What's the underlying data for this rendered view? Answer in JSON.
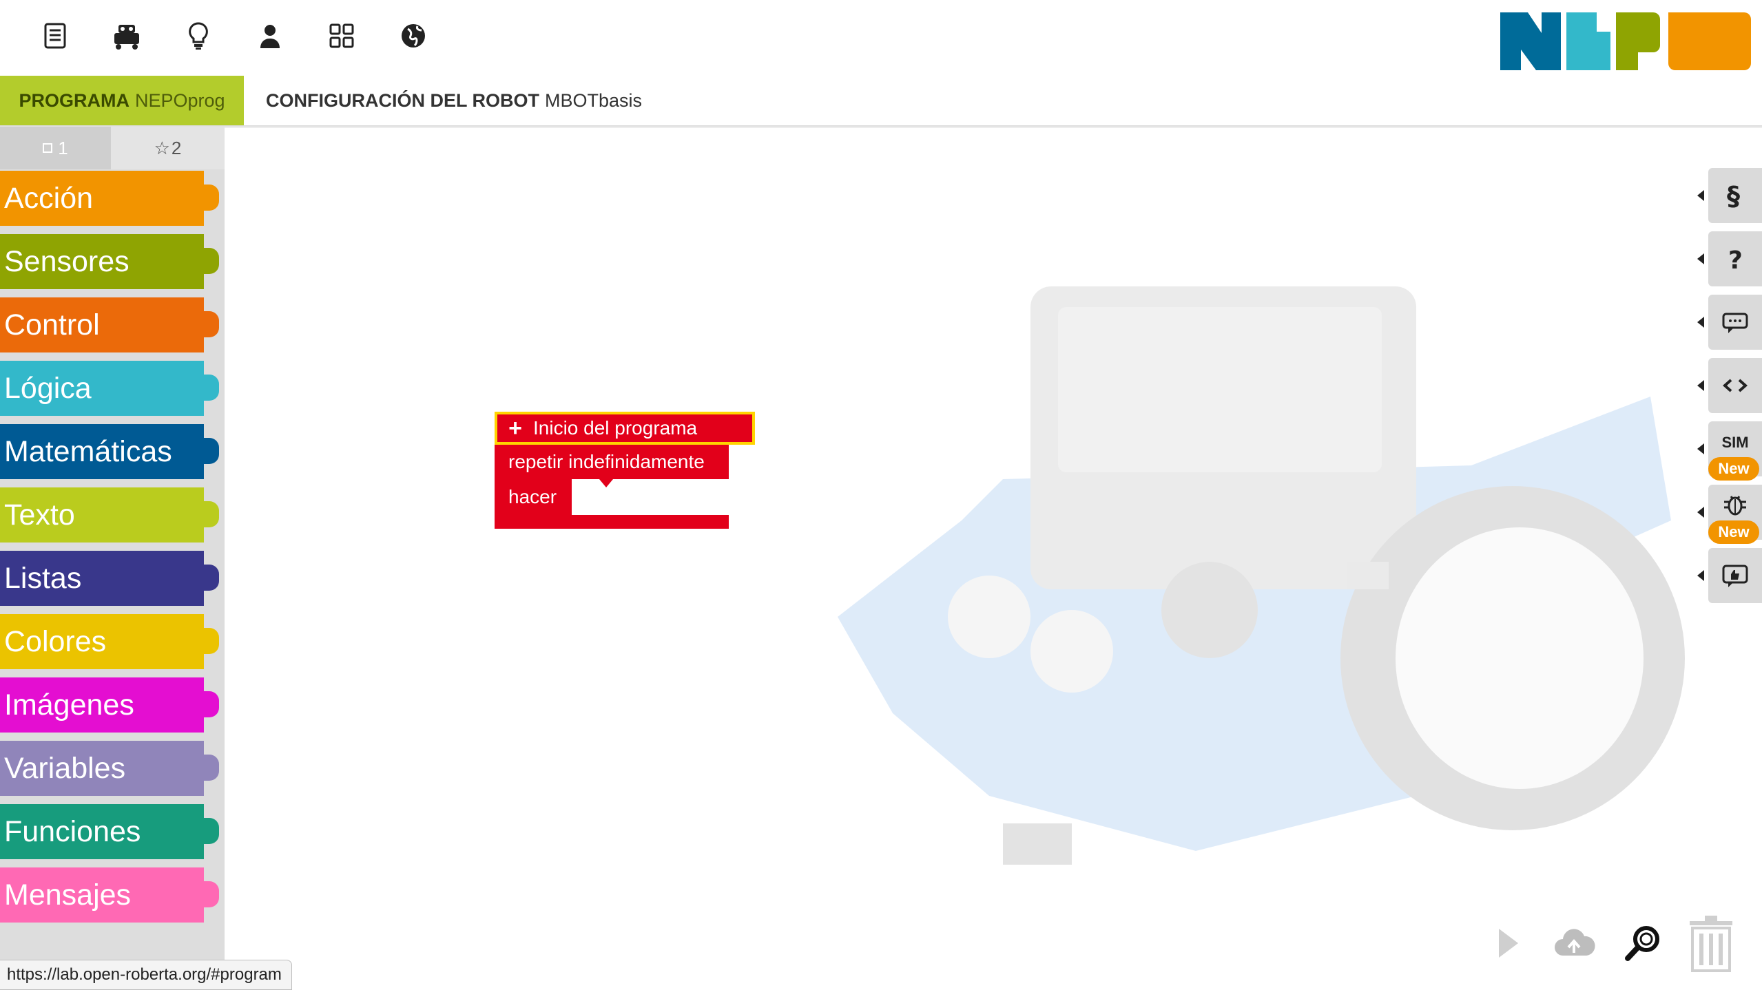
{
  "topbar": {
    "icons": [
      "edit-icon",
      "robot-icon",
      "help-bulb-icon",
      "user-icon",
      "gallery-icon",
      "language-globe-icon"
    ],
    "logo_colors": [
      "#006b99",
      "#33b8ca",
      "#8fa402",
      "#f29400"
    ]
  },
  "tabs": {
    "program_label": "PROGRAMA",
    "program_name": "NEPOprog",
    "config_label": "CONFIGURACIÓN DEL ROBOT",
    "config_name": "MBOTbasis"
  },
  "toolbox": {
    "levels": [
      "1",
      "2"
    ],
    "categories": [
      {
        "label": "Acción",
        "color": "#f29400"
      },
      {
        "label": "Sensores",
        "color": "#8fa402"
      },
      {
        "label": "Control",
        "color": "#eb6a0a"
      },
      {
        "label": "Lógica",
        "color": "#33b8ca"
      },
      {
        "label": "Matemáticas",
        "color": "#005a94"
      },
      {
        "label": "Texto",
        "color": "#bacc1e"
      },
      {
        "label": "Listas",
        "color": "#39378b"
      },
      {
        "label": "Colores",
        "color": "#ebc300"
      },
      {
        "label": "Imágenes",
        "color": "#e40ed1"
      },
      {
        "label": "Variables",
        "color": "#9085ba"
      },
      {
        "label": "Funciones",
        "color": "#179c7d"
      },
      {
        "label": "Mensajes",
        "color": "#ff69b4"
      }
    ]
  },
  "blocks": {
    "start": "Inicio del programa",
    "loop": "repetir indefinidamente",
    "do": "hacer",
    "color": "#e2001a"
  },
  "right_panel": {
    "sim_label": "SIM",
    "new_badge": "New",
    "buttons": [
      "settings-icon",
      "help-icon",
      "info-comment-icon",
      "code-icon",
      "sim-button",
      "debug-icon",
      "feedback-icon"
    ]
  },
  "bottom_controls": [
    "run-icon",
    "upload-cloud-icon",
    "zoom-reset-icon",
    "trash-icon"
  ],
  "status_url": "https://lab.open-roberta.org/#program"
}
